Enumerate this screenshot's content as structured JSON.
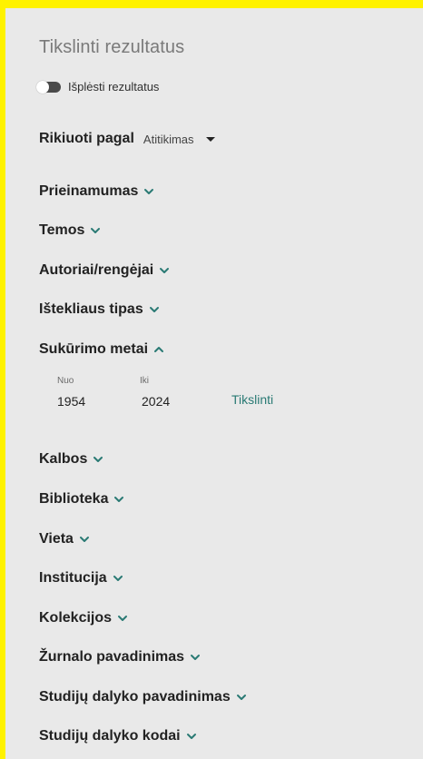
{
  "panel": {
    "title": "Tikslinti rezultatus",
    "expand_toggle_label": "Išplėsti rezultatus",
    "sort": {
      "label": "Rikiuoti pagal",
      "value": "Atitikimas"
    },
    "facets": [
      {
        "label": "Prieinamumas",
        "expanded": false
      },
      {
        "label": "Temos",
        "expanded": false
      },
      {
        "label": "Autoriai/rengėjai",
        "expanded": false
      },
      {
        "label": "Ištekliaus tipas",
        "expanded": false
      },
      {
        "label": "Sukūrimo metai",
        "expanded": true
      },
      {
        "label": "Kalbos",
        "expanded": false
      },
      {
        "label": "Biblioteka",
        "expanded": false
      },
      {
        "label": "Vieta",
        "expanded": false
      },
      {
        "label": "Institucija",
        "expanded": false
      },
      {
        "label": "Kolekcijos",
        "expanded": false
      },
      {
        "label": "Žurnalo pavadinimas",
        "expanded": false
      },
      {
        "label": "Studijų dalyko pavadinimas",
        "expanded": false
      },
      {
        "label": "Studijų dalyko kodai",
        "expanded": false
      }
    ],
    "year_filter": {
      "from_label": "Nuo",
      "to_label": "Iki",
      "from_value": "1954",
      "to_value": "2024",
      "refine_label": "Tikslinti"
    }
  },
  "colors": {
    "frame": "#fff200",
    "panel_bg": "#e9e9e9",
    "accent": "#2a7a74",
    "text": "#222222",
    "muted": "#7a7a7a"
  },
  "icons": {
    "collapsed": "chevron-down-icon",
    "expanded": "chevron-up-icon",
    "sort_caret": "caret-down-icon"
  }
}
